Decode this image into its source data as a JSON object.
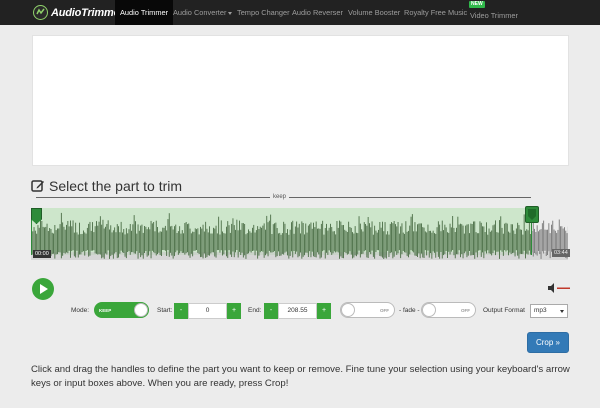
{
  "nav": {
    "brand": "AudioTrimmer",
    "items": [
      {
        "label": "Audio Trimmer",
        "active": true
      },
      {
        "label": "Audio Converter",
        "dropdown": true
      },
      {
        "label": "Tempo Changer"
      },
      {
        "label": "Audio Reverser"
      },
      {
        "label": "Volume Booster"
      },
      {
        "label": "Royalty Free Music"
      },
      {
        "label": "Video Trimmer",
        "badge": "NEW"
      }
    ]
  },
  "editor": {
    "title": "Select the part to trim",
    "keep_label": "keep",
    "start_time_badge": "00:00",
    "end_time_badge": "03:44",
    "selection_fraction": 0.93
  },
  "controls": {
    "mode_label": "Mode:",
    "mode_toggle": "KEEP",
    "start_label": "Start:",
    "start_value": "0",
    "end_label": "End:",
    "end_value": "208.55",
    "minus": "-",
    "plus": "+",
    "fade_in_toggle": "OFF",
    "fade_label": "- fade -",
    "fade_out_toggle": "OFF",
    "output_label": "Output Format",
    "output_value": "mp3"
  },
  "crop_button": "Crop »",
  "instructions": "Click and drag the handles to define the part you want to keep or remove. Fine tune your selection using your keyboard's arrow keys or input boxes above. When you are ready, press Crop!",
  "colors": {
    "accent_green": "#3aa63a",
    "primary_blue": "#337ab7",
    "nav_bg": "#222222"
  }
}
